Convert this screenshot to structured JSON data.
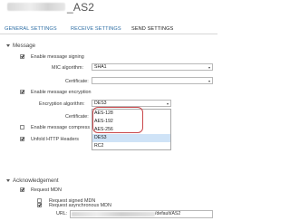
{
  "header": {
    "title": "_AS2"
  },
  "tabs": [
    {
      "label": "GENERAL SETTINGS"
    },
    {
      "label": "RECEIVE SETTINGS"
    },
    {
      "label": "SEND SETTINGS"
    }
  ],
  "message": {
    "header": "Message",
    "enable_signing": {
      "label": "Enable message signing",
      "checked": true
    },
    "mic_algorithm": {
      "label": "MIC algorithm:",
      "value": "SHA1"
    },
    "certificate": {
      "label": "Certificate:",
      "value": ""
    },
    "enable_encryption": {
      "label": "Enable message encryption",
      "checked": true
    },
    "encryption_algorithm": {
      "label": "Encryption algorithm:",
      "value": "DES3",
      "options": [
        "AES-128",
        "AES-192",
        "AES-256",
        "DES3",
        "RC2"
      ]
    },
    "certificate2": {
      "label": "Certificate:"
    },
    "enable_compression": {
      "label": "Enable message compress",
      "checked": false
    },
    "unfold_http_headers": {
      "label": "Unfold HTTP Headers",
      "checked": true
    }
  },
  "acknowledgement": {
    "header": "Acknowledgement",
    "request_mdn": {
      "label": "Request MDN",
      "checked": true
    },
    "request_signed_mdn": {
      "label": "Request signed MDN",
      "checked": false
    },
    "request_async_mdn": {
      "label": "Request asynchronous MDN",
      "checked": true
    },
    "url": {
      "label": "URL:",
      "value_tail": "/default/AS2"
    }
  },
  "colors": {
    "tab_link": "#2b6ca3",
    "highlight_ring": "#c9474b",
    "selected_option_bg": "#cfe3f7"
  },
  "icons": {
    "section_toggle": "triangle-down-icon",
    "select_arrow": "chevron-down-icon",
    "checkbox": "checkmark-icon"
  }
}
